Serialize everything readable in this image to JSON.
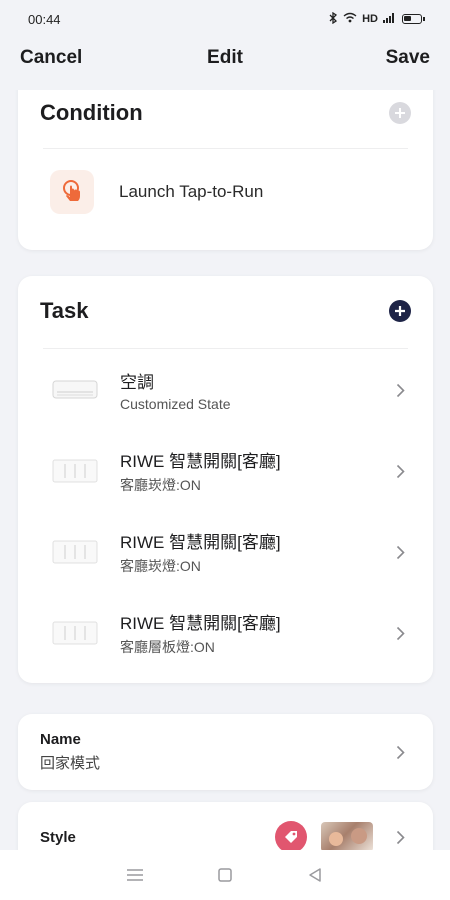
{
  "status_bar": {
    "time": "00:44",
    "network": "HD",
    "icons": [
      "bluetooth-icon",
      "wifi-icon",
      "signal-icon",
      "battery-icon"
    ]
  },
  "nav": {
    "cancel_label": "Cancel",
    "title": "Edit",
    "save_label": "Save"
  },
  "condition": {
    "title": "Condition",
    "add_icon": "plus-circle-icon",
    "items": [
      {
        "icon": "tap-hand-icon",
        "label": "Launch Tap-to-Run"
      }
    ]
  },
  "task": {
    "title": "Task",
    "add_icon": "plus-circle-icon",
    "items": [
      {
        "icon": "air-conditioner-icon",
        "title": "空調",
        "subtitle": "Customized State"
      },
      {
        "icon": "smart-switch-icon",
        "title": "RIWE 智慧開關[客廳]",
        "subtitle": "客廳崁燈:ON"
      },
      {
        "icon": "smart-switch-icon",
        "title": "RIWE 智慧開關[客廳]",
        "subtitle": "客廳崁燈:ON"
      },
      {
        "icon": "smart-switch-icon",
        "title": "RIWE 智慧開關[客廳]",
        "subtitle": "客廳層板燈:ON"
      }
    ]
  },
  "name": {
    "label": "Name",
    "value": "回家模式"
  },
  "style": {
    "label": "Style",
    "tag_color": "#e1566f"
  },
  "colors": {
    "accent_dark": "#1e2447",
    "tap_icon": "#ee6a3a",
    "background": "#f2f3f7"
  },
  "bottom_nav": [
    "menu-icon",
    "home-square-icon",
    "back-triangle-icon"
  ]
}
